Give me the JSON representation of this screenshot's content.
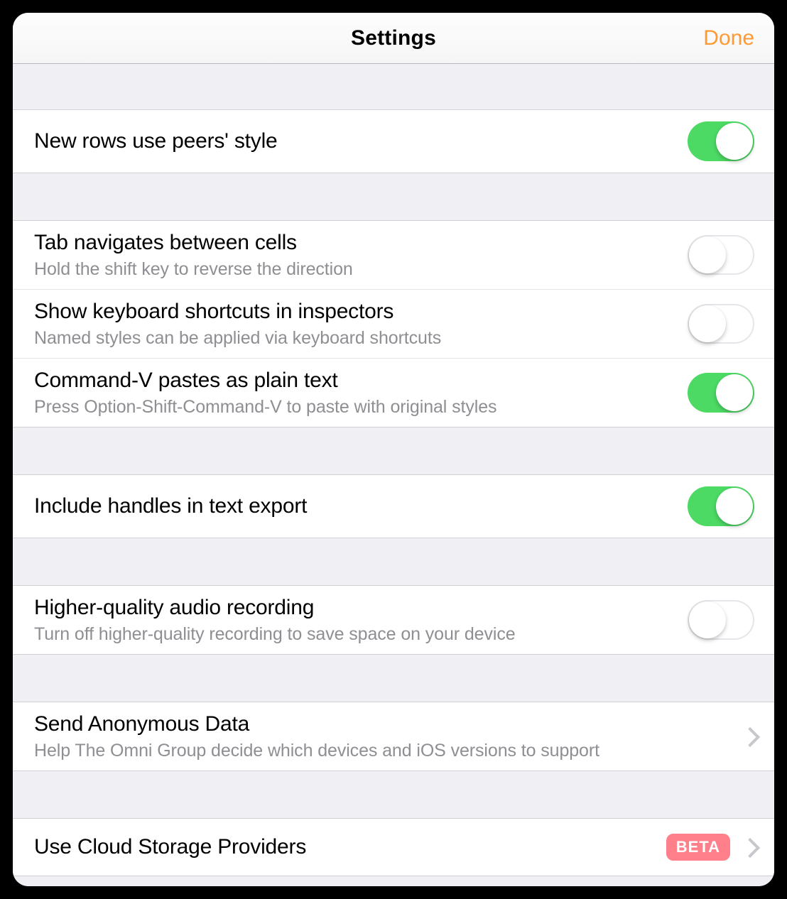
{
  "header": {
    "title": "Settings",
    "done_label": "Done"
  },
  "group1": {
    "item0": {
      "title": "New rows use peers' style",
      "on": true
    }
  },
  "group2": {
    "item0": {
      "title": "Tab navigates between cells",
      "subtitle": "Hold the shift key to reverse the direction",
      "on": false
    },
    "item1": {
      "title": "Show keyboard shortcuts in inspectors",
      "subtitle": "Named styles can be applied via keyboard shortcuts",
      "on": false
    },
    "item2": {
      "title": "Command-V pastes as plain text",
      "subtitle": "Press Option-Shift-Command-V to paste with original styles",
      "on": true
    }
  },
  "group3": {
    "item0": {
      "title": "Include handles in text export",
      "on": true
    }
  },
  "group4": {
    "item0": {
      "title": "Higher-quality audio recording",
      "subtitle": "Turn off higher-quality recording to save space on your device",
      "on": false
    }
  },
  "group5": {
    "item0": {
      "title": "Send Anonymous Data",
      "subtitle": "Help The Omni Group decide which devices and iOS versions to support"
    }
  },
  "group6": {
    "item0": {
      "title": "Use Cloud Storage Providers",
      "badge": "BETA"
    }
  }
}
